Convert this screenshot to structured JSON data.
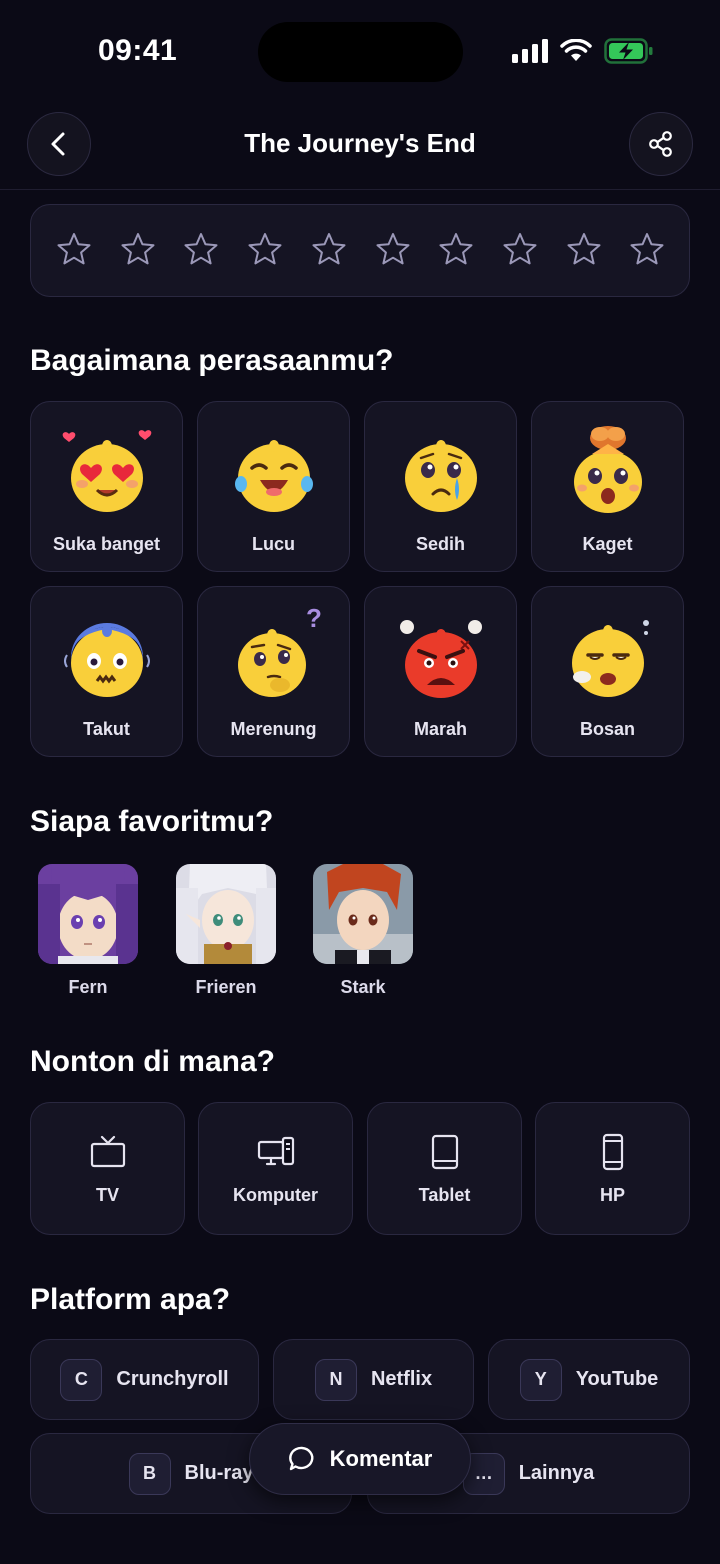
{
  "status_bar": {
    "time": "09:41",
    "battery_color": "#34c759"
  },
  "nav": {
    "title": "The Journey's End",
    "back_icon": "chevron-left-icon",
    "share_icon": "share-icon"
  },
  "rating": {
    "max": 10,
    "value": 0,
    "star_color": "#9b98b8"
  },
  "emotions": {
    "title": "Bagaimana perasaanmu?",
    "items": [
      {
        "label": "Suka banget",
        "icon": "heart-eyes-emoji"
      },
      {
        "label": "Lucu",
        "icon": "laughing-emoji"
      },
      {
        "label": "Sedih",
        "icon": "crying-emoji"
      },
      {
        "label": "Kaget",
        "icon": "shocked-emoji"
      },
      {
        "label": "Takut",
        "icon": "scared-emoji"
      },
      {
        "label": "Merenung",
        "icon": "thinking-emoji"
      },
      {
        "label": "Marah",
        "icon": "angry-emoji"
      },
      {
        "label": "Bosan",
        "icon": "bored-emoji"
      }
    ]
  },
  "favorites": {
    "title": "Siapa favoritmu?",
    "characters": [
      {
        "name": "Fern",
        "hair": "#6b3fa0"
      },
      {
        "name": "Frieren",
        "hair": "#e8e8ef"
      },
      {
        "name": "Stark",
        "hair": "#c1451f"
      }
    ]
  },
  "devices": {
    "title": "Nonton di mana?",
    "items": [
      {
        "label": "TV",
        "icon": "tv-icon"
      },
      {
        "label": "Komputer",
        "icon": "computer-icon"
      },
      {
        "label": "Tablet",
        "icon": "tablet-icon"
      },
      {
        "label": "HP",
        "icon": "phone-icon"
      }
    ]
  },
  "platforms": {
    "title": "Platform apa?",
    "items": [
      {
        "badge": "C",
        "label": "Crunchyroll"
      },
      {
        "badge": "N",
        "label": "Netflix"
      },
      {
        "badge": "Y",
        "label": "YouTube"
      },
      {
        "badge": "B",
        "label": "Blu-ray"
      },
      {
        "badge": "…",
        "label": "Lainnya"
      }
    ]
  },
  "comment_button": {
    "label": "Komentar",
    "icon": "chat-bubble-icon"
  }
}
